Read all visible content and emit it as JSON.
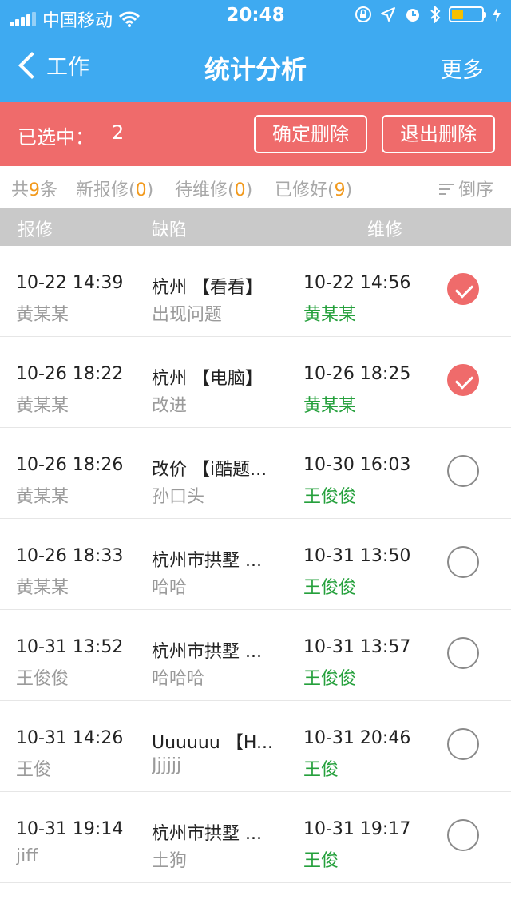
{
  "status_bar": {
    "carrier": "中国移动",
    "time": "20:48"
  },
  "nav": {
    "back_label": "工作",
    "title": "统计分析",
    "more_label": "更多"
  },
  "selection": {
    "label": "已选中：",
    "count": "2",
    "confirm_label": "确定删除",
    "exit_label": "退出删除"
  },
  "filters": {
    "total_prefix": "共",
    "total_count": "9",
    "total_suffix": "条",
    "new_label": "新报修(",
    "new_count": "0",
    "pending_label": "待维修(",
    "pending_count": "0",
    "done_label": "已修好(",
    "done_count": "9",
    "close_paren": ")",
    "sort_label": "倒序"
  },
  "columns": {
    "report": "报修",
    "defect": "缺陷",
    "repair": "维修"
  },
  "rows": [
    {
      "report_time": "10-22 14:39",
      "reporter": "黄某某",
      "defect_title": "杭州 【看看】",
      "defect_desc": "出现问题",
      "repair_time": "10-22 14:56",
      "repairer": "黄某某",
      "selected": true
    },
    {
      "report_time": "10-26 18:22",
      "reporter": "黄某某",
      "defect_title": "杭州 【电脑】",
      "defect_desc": "改进",
      "repair_time": "10-26 18:25",
      "repairer": "黄某某",
      "selected": true
    },
    {
      "report_time": "10-26 18:26",
      "reporter": "黄某某",
      "defect_title": "改价 【i酷题...",
      "defect_desc": "孙口头",
      "repair_time": "10-30 16:03",
      "repairer": "王俊俊",
      "selected": false
    },
    {
      "report_time": "10-26 18:33",
      "reporter": "黄某某",
      "defect_title": "杭州市拱墅 ...",
      "defect_desc": "哈哈",
      "repair_time": "10-31 13:50",
      "repairer": "王俊俊",
      "selected": false
    },
    {
      "report_time": "10-31 13:52",
      "reporter": "王俊俊",
      "defect_title": "杭州市拱墅 ...",
      "defect_desc": "哈哈哈",
      "repair_time": "10-31 13:57",
      "repairer": "王俊俊",
      "selected": false
    },
    {
      "report_time": "10-31 14:26",
      "reporter": "王俊",
      "defect_title": "Uuuuuu 【H...",
      "defect_desc": "Jjjjjj",
      "repair_time": "10-31 20:46",
      "repairer": "王俊",
      "selected": false
    },
    {
      "report_time": "10-31 19:14",
      "reporter": "jiff",
      "defect_title": "杭州市拱墅 ...",
      "defect_desc": "土狗",
      "repair_time": "10-31 19:17",
      "repairer": "王俊",
      "selected": false
    }
  ]
}
